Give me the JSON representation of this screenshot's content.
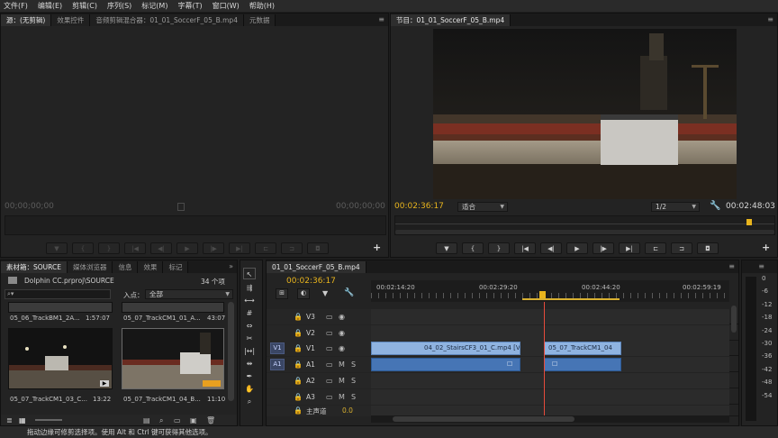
{
  "menu": [
    "文件(F)",
    "编辑(E)",
    "剪辑(C)",
    "序列(S)",
    "标记(M)",
    "字幕(T)",
    "窗口(W)",
    "帮助(H)"
  ],
  "source_panel": {
    "tabs": [
      "源：(无剪辑)",
      "效果控件",
      "音频剪辑混合器：01_01_SoccerF_05_B.mp4",
      "元数据"
    ],
    "timecode_left": "00;00;00;00",
    "timecode_right": "00;00;00;00"
  },
  "program_panel": {
    "tabs": [
      "节目：01_01_SoccerF_05_B.mp4"
    ],
    "timecode_left": "00:02:36:17",
    "fit_label": "适合",
    "resolution_label": "1/2",
    "timecode_right": "00:02:48:03"
  },
  "project_panel": {
    "tabs": [
      "素材箱：SOURCE",
      "媒体浏览器",
      "信息",
      "效果",
      "标记"
    ],
    "path": "Dolphin CC.prproj\\SOURCE",
    "count": "34 个项",
    "search_placeholder": "",
    "in_point_label": "入点：",
    "in_point_value": "全部",
    "clips": [
      {
        "name": "05_06_TrackBM1_2A...",
        "duration": "1:57:07"
      },
      {
        "name": "05_07_TrackCM1_01_A...",
        "duration": "43:07"
      },
      {
        "name": "05_07_TrackCM1_03_C...",
        "duration": "13:22"
      },
      {
        "name": "05_07_TrackCM1_04_B...",
        "duration": "11:10"
      }
    ]
  },
  "timeline": {
    "tab": "01_01_SoccerF_05_B.mp4",
    "timecode": "00:02:36:17",
    "ruler_labels": [
      "00:02:14:20",
      "00:02:29:20",
      "00:02:44:20",
      "00:02:59:19"
    ],
    "tracks": [
      {
        "name": "V3",
        "patch": ""
      },
      {
        "name": "V2",
        "patch": ""
      },
      {
        "name": "V1",
        "patch": "V1"
      },
      {
        "name": "A1",
        "patch": "A1"
      },
      {
        "name": "A2",
        "patch": ""
      },
      {
        "name": "A3",
        "patch": ""
      }
    ],
    "master_label": "主声道",
    "master_value": "0.0",
    "mute_label": "M",
    "solo_label": "S",
    "clips": {
      "v1_a": "04_02_StairsCF3_01_C.mp4 [V]",
      "v1_b": "05_07_TrackCM1_04"
    }
  },
  "meter_labels": [
    "0",
    "-6",
    "-12",
    "-18",
    "-24",
    "-30",
    "-36",
    "-42",
    "-48",
    "-54"
  ],
  "status": "拖动边缘可修剪选择项。使用 Alt 和 Ctrl 键可获得其他选项。",
  "colors": {
    "timecode": "#e8b41d",
    "playhead": "#e74b3c",
    "video_clip": "#8fb3e0",
    "audio_clip": "#4675b5"
  }
}
